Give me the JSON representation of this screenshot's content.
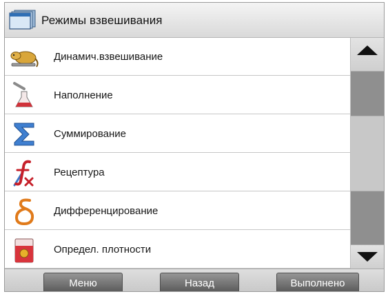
{
  "header": {
    "title": "Режимы взвешивания",
    "icon": "window-stack-icon"
  },
  "list": {
    "items": [
      {
        "label": "Динамич.взвешивание",
        "icon": "animal-icon"
      },
      {
        "label": "Наполнение",
        "icon": "filling-flask-icon"
      },
      {
        "label": "Суммирование",
        "icon": "sigma-icon"
      },
      {
        "label": "Рецептура",
        "icon": "formula-icon"
      },
      {
        "label": "Дифференцирование",
        "icon": "delta-icon"
      },
      {
        "label": "Определ. плотности",
        "icon": "density-beaker-icon"
      }
    ]
  },
  "footer": {
    "menu": "Меню",
    "back": "Назад",
    "done": "Выполнено"
  },
  "colors": {
    "button_dark": "#5a5a5a",
    "scrollbar_track": "#8f8f8f",
    "header_bg": "#e2e2e2"
  }
}
